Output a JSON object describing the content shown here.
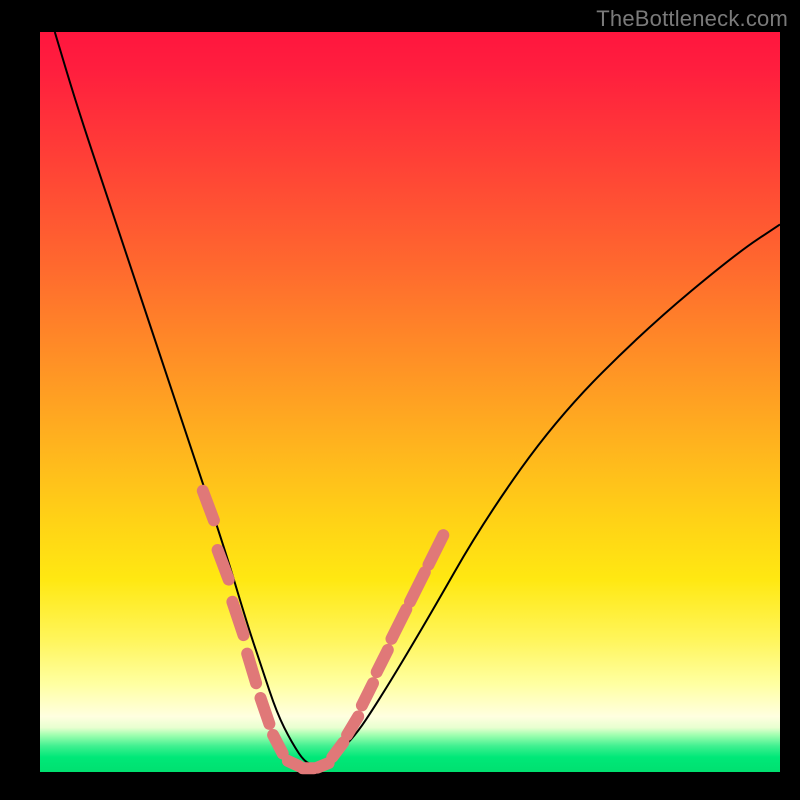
{
  "watermark": "TheBottleneck.com",
  "chart_data": {
    "type": "line",
    "title": "",
    "xlabel": "",
    "ylabel": "",
    "xlim": [
      0,
      100
    ],
    "ylim": [
      0,
      100
    ],
    "series": [
      {
        "name": "bottleneck-curve",
        "x": [
          2,
          5,
          9,
          13,
          17,
          21,
          25,
          28,
          30,
          32,
          34,
          36,
          38,
          42,
          46,
          52,
          60,
          70,
          82,
          94,
          100
        ],
        "y": [
          100,
          90,
          78,
          66,
          54,
          42,
          30,
          20,
          14,
          8,
          4,
          1,
          1,
          4,
          10,
          20,
          34,
          48,
          60,
          70,
          74
        ]
      }
    ],
    "highlight_segments": {
      "name": "pink-dashes",
      "note": "short dashed overlay near the valley of the curve",
      "segments": [
        {
          "x": [
            22,
            23.5
          ],
          "y": [
            38,
            34
          ]
        },
        {
          "x": [
            24,
            25.5
          ],
          "y": [
            30,
            26
          ]
        },
        {
          "x": [
            26,
            27.5
          ],
          "y": [
            23,
            18.5
          ]
        },
        {
          "x": [
            28,
            29.2
          ],
          "y": [
            16,
            12
          ]
        },
        {
          "x": [
            29.8,
            31
          ],
          "y": [
            10,
            6.5
          ]
        },
        {
          "x": [
            31.5,
            32.8
          ],
          "y": [
            5,
            2.5
          ]
        },
        {
          "x": [
            33.5,
            35
          ],
          "y": [
            1.5,
            0.8
          ]
        },
        {
          "x": [
            35.5,
            37
          ],
          "y": [
            0.5,
            0.5
          ]
        },
        {
          "x": [
            37.5,
            39
          ],
          "y": [
            0.6,
            1.2
          ]
        },
        {
          "x": [
            39.5,
            41
          ],
          "y": [
            2,
            4
          ]
        },
        {
          "x": [
            41.5,
            43
          ],
          "y": [
            5,
            7.5
          ]
        },
        {
          "x": [
            43.5,
            45
          ],
          "y": [
            9,
            12
          ]
        },
        {
          "x": [
            45.5,
            47
          ],
          "y": [
            13.5,
            16.5
          ]
        },
        {
          "x": [
            47.5,
            49.5
          ],
          "y": [
            18,
            22
          ]
        },
        {
          "x": [
            50,
            52
          ],
          "y": [
            23,
            27
          ]
        },
        {
          "x": [
            52.5,
            54.5
          ],
          "y": [
            28,
            32
          ]
        }
      ]
    },
    "background_gradient": {
      "top": "#ff163e",
      "mid": "#ffe812",
      "bottom": "#00e070"
    }
  }
}
